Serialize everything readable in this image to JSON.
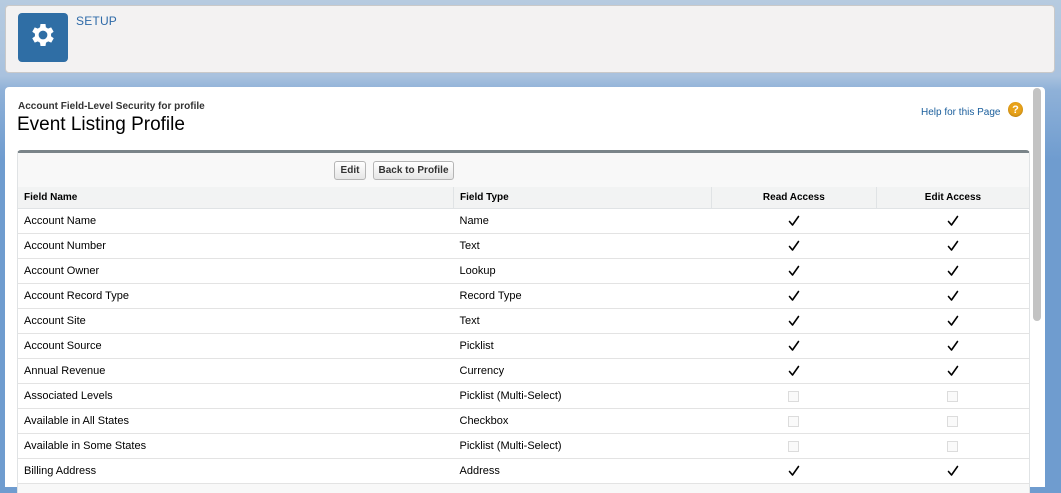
{
  "header": {
    "app_label": "SETUP",
    "icon": "gear-icon"
  },
  "page": {
    "subtitle": "Account Field-Level Security for profile",
    "title": "Event Listing Profile",
    "help_link": "Help for this Page",
    "help_icon": "?"
  },
  "toolbar": {
    "edit_label": "Edit",
    "back_label": "Back to Profile"
  },
  "table": {
    "columns": [
      "Field Name",
      "Field Type",
      "Read Access",
      "Edit Access"
    ],
    "rows": [
      {
        "name": "Account Name",
        "type": "Name",
        "read": true,
        "edit": true
      },
      {
        "name": "Account Number",
        "type": "Text",
        "read": true,
        "edit": true
      },
      {
        "name": "Account Owner",
        "type": "Lookup",
        "read": true,
        "edit": true
      },
      {
        "name": "Account Record Type",
        "type": "Record Type",
        "read": true,
        "edit": true
      },
      {
        "name": "Account Site",
        "type": "Text",
        "read": true,
        "edit": true
      },
      {
        "name": "Account Source",
        "type": "Picklist",
        "read": true,
        "edit": true
      },
      {
        "name": "Annual Revenue",
        "type": "Currency",
        "read": true,
        "edit": true
      },
      {
        "name": "Associated Levels",
        "type": "Picklist (Multi-Select)",
        "read": false,
        "edit": false
      },
      {
        "name": "Available in All States",
        "type": "Checkbox",
        "read": false,
        "edit": false
      },
      {
        "name": "Available in Some States",
        "type": "Picklist (Multi-Select)",
        "read": false,
        "edit": false
      },
      {
        "name": "Billing Address",
        "type": "Address",
        "read": true,
        "edit": true
      }
    ]
  },
  "colors": {
    "brand_blue": "#2f6ea5",
    "link_blue": "#1a5e9c",
    "help_orange": "#e8a21a"
  }
}
